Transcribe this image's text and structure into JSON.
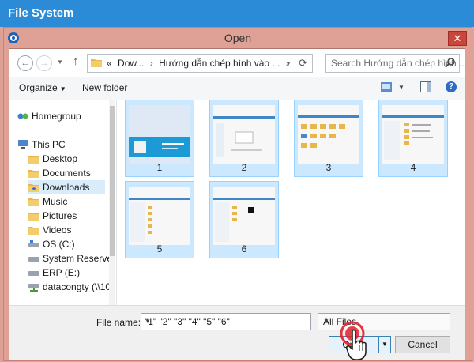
{
  "outer_window": {
    "title": "File System"
  },
  "dialog": {
    "title": "Open",
    "close_glyph": "✕",
    "app_icon": "eye-icon"
  },
  "address_bar": {
    "back_glyph": "←",
    "forward_glyph": "→",
    "up_glyph": "↑",
    "crumbs": [
      "«",
      "Dow...",
      "›",
      "Hướng dẫn chép hình vào ...",
      "›"
    ],
    "refresh_glyph": "⟳",
    "dropdown_glyph": "▼"
  },
  "search": {
    "placeholder": "Search Hướng dẫn chép hình ..."
  },
  "toolbar": {
    "organize_label": "Organize",
    "organize_chevron": "▼",
    "new_folder_label": "New folder",
    "view_chevron": "▼",
    "help_glyph": "?"
  },
  "nav_pane": {
    "items": [
      {
        "label": "Homegroup",
        "icon": "homegroup-icon"
      },
      {
        "label": "This PC",
        "icon": "computer-icon"
      },
      {
        "label": "Desktop",
        "icon": "folder-icon"
      },
      {
        "label": "Documents",
        "icon": "folder-icon"
      },
      {
        "label": "Downloads",
        "icon": "folder-icon",
        "selected": true
      },
      {
        "label": "Music",
        "icon": "folder-icon"
      },
      {
        "label": "Pictures",
        "icon": "folder-icon"
      },
      {
        "label": "Videos",
        "icon": "folder-icon"
      },
      {
        "label": "OS (C:)",
        "icon": "drive-icon"
      },
      {
        "label": "System Reserved",
        "icon": "drive-icon"
      },
      {
        "label": "ERP (E:)",
        "icon": "drive-icon"
      },
      {
        "label": "datacongty (\\\\10",
        "icon": "network-drive-icon"
      }
    ]
  },
  "files": [
    {
      "label": "1"
    },
    {
      "label": "2"
    },
    {
      "label": "3"
    },
    {
      "label": "4"
    },
    {
      "label": "5"
    },
    {
      "label": "6"
    }
  ],
  "bottom": {
    "file_name_label": "File name:",
    "file_name_value": "\"1\" \"2\" \"3\" \"4\" \"5\" \"6\"",
    "filter_value": "All Files",
    "open_label": "Open",
    "split_glyph": "▼",
    "cancel_label": "Cancel",
    "dropdown_glyph": "▼"
  },
  "colors": {
    "title_bar": "#2c8bd6",
    "dialog_frame": "#dfa095",
    "selection": "#cce8ff",
    "click_ring": "#e0202a"
  }
}
